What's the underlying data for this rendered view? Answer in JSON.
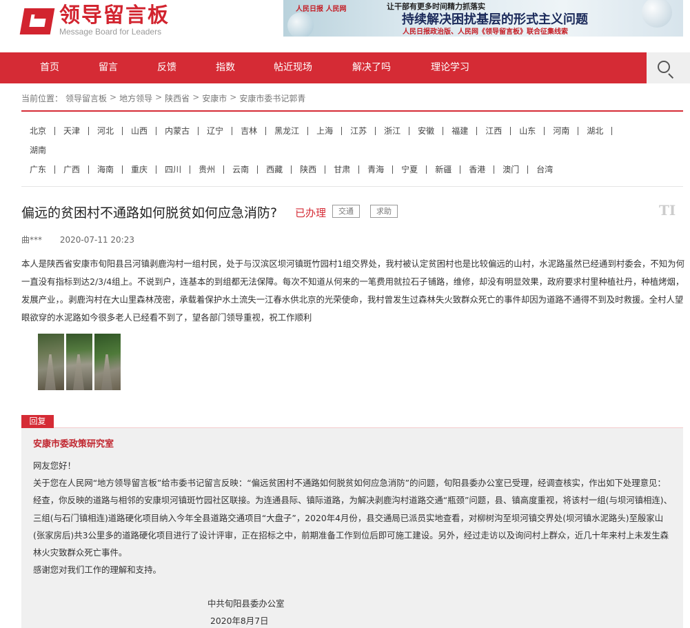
{
  "header": {
    "logo_title": "领导留言板",
    "logo_sub": "Message Board for Leaders",
    "banner": {
      "logos": "人民日报 人民网",
      "line1": "让干部有更多时间精力抓落实",
      "line2": "持续解决困扰基层的形式主义问题",
      "line3": "人民日报政治版、人民网《领导留言板》联合征集线索"
    }
  },
  "nav": {
    "items": [
      "首页",
      "留言",
      "反馈",
      "指数",
      "帖近现场",
      "解决了吗",
      "理论学习"
    ],
    "search_icon": "search-icon"
  },
  "breadcrumb": {
    "label": "当前位置：",
    "items": [
      "领导留言板",
      "地方领导",
      "陕西省",
      "安康市",
      "安康市委书记郭青"
    ]
  },
  "provinces": {
    "row1": [
      "北京",
      "天津",
      "河北",
      "山西",
      "内蒙古",
      "辽宁",
      "吉林",
      "黑龙江",
      "上海",
      "江苏",
      "浙江",
      "安徽",
      "福建",
      "江西",
      "山东",
      "河南",
      "湖北"
    ],
    "row2": [
      "湖南"
    ],
    "row3": [
      "广东",
      "广西",
      "海南",
      "重庆",
      "四川",
      "贵州",
      "云南",
      "西藏",
      "陕西",
      "甘肃",
      "青海",
      "宁夏",
      "新疆",
      "香港",
      "澳门",
      "台湾"
    ]
  },
  "post": {
    "title": "偏远的贫困村不通路如何脱贫如何应急消防?",
    "status": "已办理",
    "tags": [
      "交通",
      "求助"
    ],
    "font_icon": "TI",
    "author": "曲***",
    "date": "2020-07-11 20:23",
    "content": "本人是陕西省安康市旬阳县吕河镇剥鹿沟村一组村民，处于与汉滨区坝河镇斑竹园村1组交界处，我村被认定贫困村也是比较偏远的山村，水泥路虽然已经通到村委会，不知为何一直没有指标到达2/3/4组上。不说到户，连基本的到组都无法保障。每次不知道从何来的一笔费用就拉石子铺路，维修，却没有明显效果，政府要求村里种植社丹，种植烤烟，发展产业，。剥鹿沟村在大山里森林茂密，承载着保护水土流失一江春水供北京的光荣使命，我村曾发生过森林失火致群众死亡的事件却因为道路不通得不到及时救援。全村人望眼欲穿的水泥路如今很多老人已经看不到了，望各部门领导重视，祝工作顺利"
  },
  "reply": {
    "tag": "回复",
    "org": "安康市委政策研究室",
    "greeting": "网友您好！",
    "p1": "关于您在人民网“地方领导留言板”给市委书记留言反映：“偏远贫困村不通路如何脱贫如何应急消防”的问题，旬阳县委办公室已受理，经调查核实，作出如下处理意见：",
    "p2": "经查，你反映的道路与相邻的安康坝河镇斑竹园社区联接。为连通县际、镇际道路，为解决剥鹿沟村道路交通“瓶颈”问题，县、镇高度重视，将该村一组(与坝河镇相连)、三组(与石门镇相连)道路硬化项目纳入今年全县道路交通项目“大盘子”，2020年4月份，县交通局已派员实地查看，对柳树沟至坝河镇交界处(坝河镇水泥路头)至殷家山(张家房后)共3公里多的道路硬化项目进行了设计评审，正在招标之中，前期准备工作到位后即可施工建设。另外，经过走访以及询问村上群众，近几十年来村上未发生森林火灾致群众死亡事件。",
    "p3": "感谢您对我们工作的理解和支持。",
    "sign_org": "中共旬阳县委办公室",
    "sign_date": "2020年8月7日"
  }
}
